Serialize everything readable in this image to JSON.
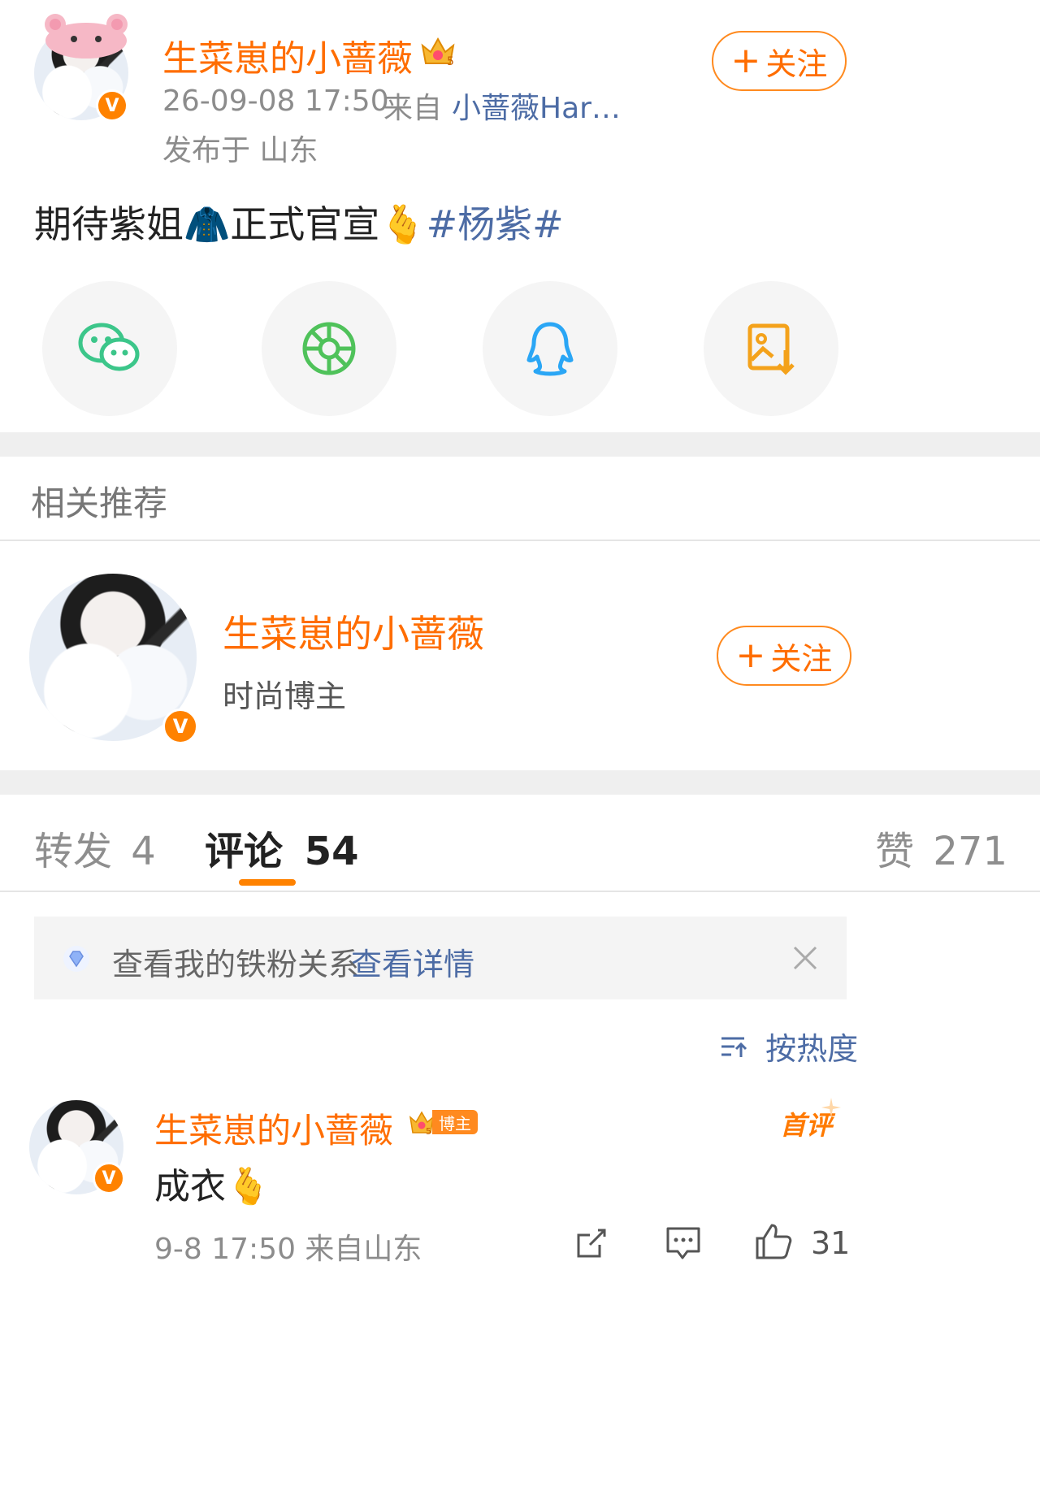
{
  "post": {
    "author": "生菜崽的小蔷薇",
    "level_badge": "5",
    "timestamp": "26-09-08 17:50",
    "source_prefix": "来自",
    "source": "小蔷薇Har…",
    "location": "发布于 山东",
    "follow_label": "关注",
    "text_part1": "期待紫姐",
    "emoji_coat": "🧥",
    "text_part2": "正式官宣",
    "emoji_hands": "🫰",
    "hashtag": "#杨紫#"
  },
  "share": {
    "items": [
      {
        "icon": "wechat-icon",
        "color": "#3cc68a"
      },
      {
        "icon": "moments-icon",
        "color": "#4fc25a"
      },
      {
        "icon": "qq-icon",
        "color": "#2aa6f5"
      },
      {
        "icon": "save-image-icon",
        "color": "#f4a21b"
      }
    ]
  },
  "recommend": {
    "section_title": "相关推荐",
    "name": "生菜崽的小蔷薇",
    "desc": "时尚博主",
    "follow_label": "关注"
  },
  "tabs": {
    "repost_label": "转发",
    "repost_count": "4",
    "comment_label": "评论",
    "comment_count": "54",
    "like_label": "赞",
    "like_count": "271"
  },
  "notice": {
    "text": "查看我的铁粉关系",
    "link": "查看详情"
  },
  "sort": {
    "label": "按热度"
  },
  "comment": {
    "author": "生菜崽的小蔷薇",
    "level": "5",
    "role_badge": "博主",
    "first_badge": "首评",
    "text": "成衣",
    "emoji": "🫰",
    "meta": "9-8 17:50 来自山东",
    "like_count": "31"
  },
  "colors": {
    "accent": "#ff6d00",
    "link": "#4d6ca5"
  }
}
